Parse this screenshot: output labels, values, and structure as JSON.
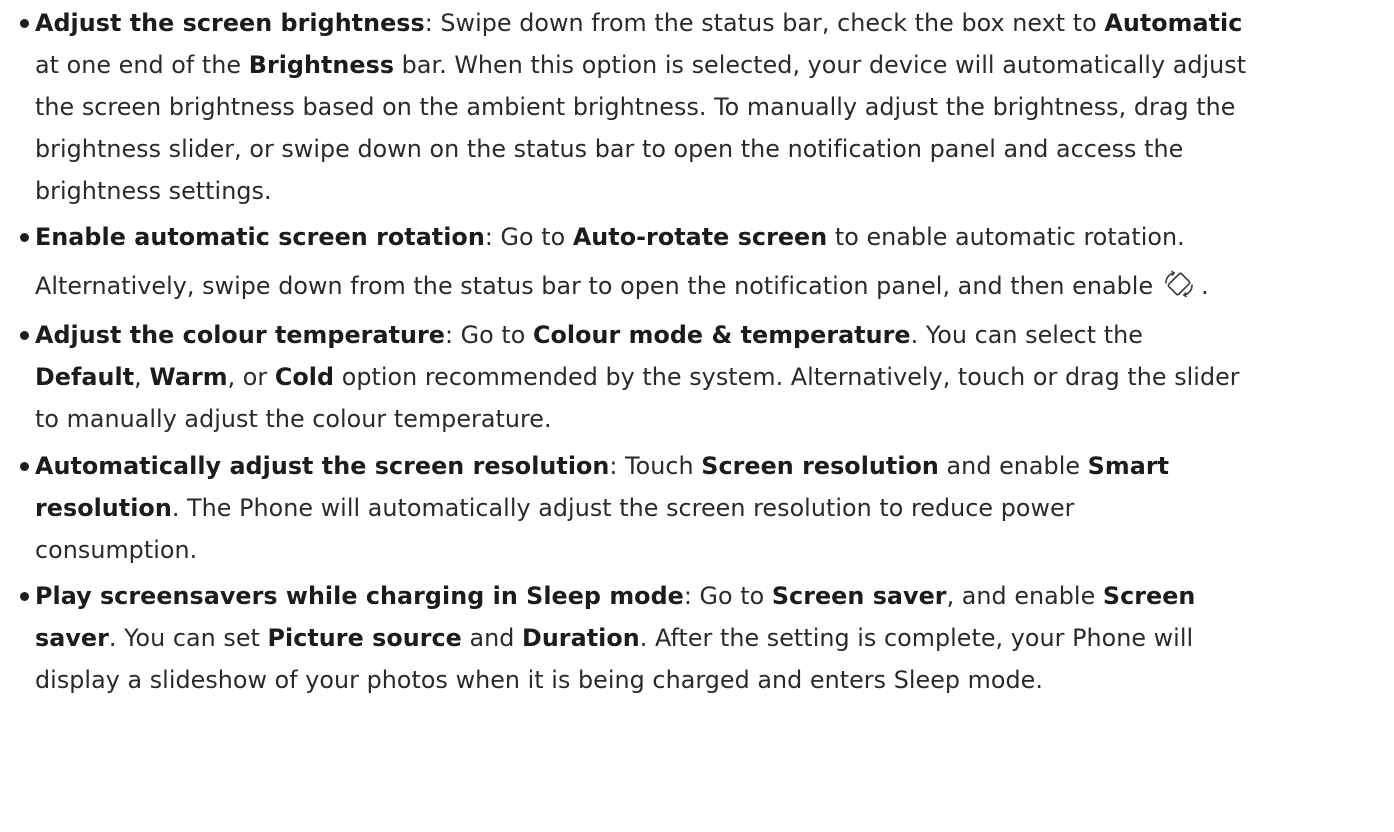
{
  "items": [
    {
      "heading": "Adjust the screen brightness",
      "lines": [
        {
          "t1": ": Swipe down from the status bar, check the box next to ",
          "b1": "Automatic"
        },
        {
          "t1": "at one end of the ",
          "b1": "Brightness",
          "t2": " bar. When this option is selected, your device will automatically adjust"
        },
        {
          "t1": "the screen brightness based on the ambient brightness. To manually adjust the brightness, drag the"
        },
        {
          "t1": "brightness slider, or swipe down on the status bar to open the notification panel and access the"
        },
        {
          "t1": "brightness settings."
        }
      ]
    },
    {
      "heading": "Enable automatic screen rotation",
      "lines": [
        {
          "t1": ": Go to ",
          "b1": "Auto-rotate screen",
          "t2": " to enable automatic rotation."
        },
        {
          "t1": "Alternatively, swipe down from the status bar to open the notification panel, and then enable",
          "icon": "rotate-icon",
          "t2": "."
        }
      ]
    },
    {
      "heading": "Adjust the colour temperature",
      "lines": [
        {
          "t1": ": Go to ",
          "b1": "Colour mode & temperature",
          "t2": ". You can select the"
        },
        {
          "b1": "Default",
          "t1": ", ",
          "b2": "Warm",
          "t2": ", or ",
          "b3": "Cold",
          "t3": " option recommended by the system. Alternatively, touch or drag the slider"
        },
        {
          "t1": "to manually adjust the colour temperature."
        }
      ]
    },
    {
      "heading": "Automatically adjust the screen resolution",
      "lines": [
        {
          "t1": ": Touch ",
          "b1": "Screen resolution",
          "t2": " and enable ",
          "b2": "Smart"
        },
        {
          "b1": "resolution",
          "t1": ". The Phone will automatically adjust the screen resolution to reduce power"
        },
        {
          "t1": "consumption."
        }
      ]
    },
    {
      "heading": "Play screensavers while charging in Sleep mode",
      "lines": [
        {
          "t1": ": Go to ",
          "b1": "Screen saver",
          "t2": ", and enable ",
          "b2": "Screen"
        },
        {
          "b1": "saver",
          "t1": ". You can set ",
          "b2": "Picture source",
          "t2": " and ",
          "b3": "Duration",
          "t3": ". After the setting is complete, your Phone will"
        },
        {
          "t1": "display a slideshow of your photos when it is being charged and enters Sleep mode."
        }
      ]
    }
  ]
}
